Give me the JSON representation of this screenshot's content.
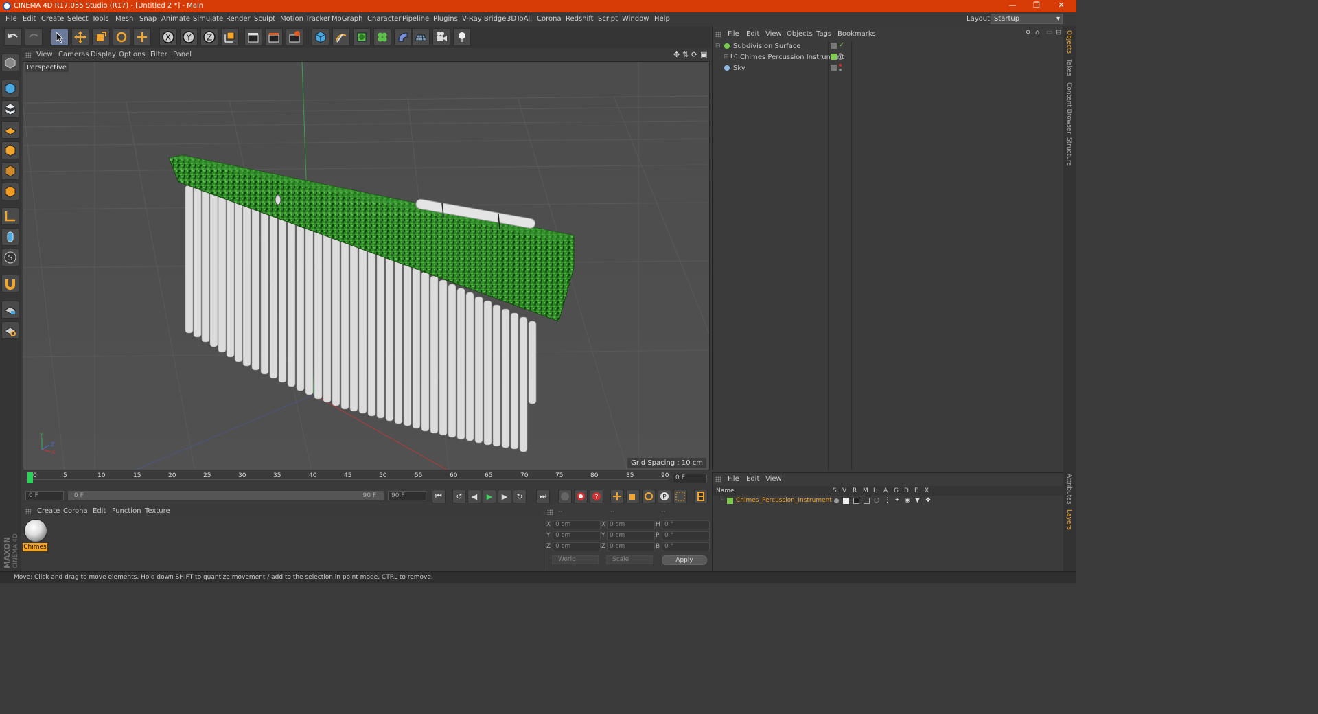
{
  "window": {
    "title": "CINEMA 4D R17.055 Studio (R17) - [Untitled 2 *] - Main"
  },
  "menubar": {
    "items": [
      "File",
      "Edit",
      "Create",
      "Select",
      "Tools",
      "Mesh",
      "Snap",
      "Animate",
      "Simulate",
      "Render",
      "Sculpt",
      "Motion Tracker",
      "MoGraph",
      "Character",
      "Pipeline",
      "Plugins",
      "V-Ray Bridge",
      "3DToAll",
      "Corona",
      "Redshift",
      "Script",
      "Window",
      "Help"
    ],
    "layout_label": "Layout:",
    "layout_value": "Startup"
  },
  "viewport": {
    "menu": [
      "View",
      "Cameras",
      "Display",
      "Options",
      "Filter",
      "Panel"
    ],
    "label": "Perspective",
    "grid_spacing": "Grid Spacing : 10 cm"
  },
  "timeline": {
    "ticks": [
      "0",
      "5",
      "10",
      "15",
      "20",
      "25",
      "30",
      "35",
      "40",
      "45",
      "50",
      "55",
      "60",
      "65",
      "70",
      "75",
      "80",
      "85",
      "90"
    ],
    "current_frame": "0 F"
  },
  "playbar": {
    "start": "0 F",
    "range_start": "0 F",
    "range_end": "90 F",
    "end": "90 F"
  },
  "material_manager": {
    "menu": [
      "Create",
      "Corona",
      "Edit",
      "Function",
      "Texture"
    ],
    "materials": [
      {
        "name": "Chimes"
      }
    ]
  },
  "coordinates": {
    "header": [
      "--",
      "--",
      "--"
    ],
    "rows": [
      {
        "l1": "X",
        "v1": "0 cm",
        "l2": "X",
        "v2": "0 cm",
        "l3": "H",
        "v3": "0 °"
      },
      {
        "l1": "Y",
        "v1": "0 cm",
        "l2": "Y",
        "v2": "0 cm",
        "l3": "P",
        "v3": "0 °"
      },
      {
        "l1": "Z",
        "v1": "0 cm",
        "l2": "Z",
        "v2": "0 cm",
        "l3": "B",
        "v3": "0 °"
      }
    ],
    "mode": "World",
    "scale": "Scale",
    "apply": "Apply"
  },
  "object_manager": {
    "menu": [
      "File",
      "Edit",
      "View",
      "Objects",
      "Tags",
      "Bookmarks"
    ],
    "objects": [
      {
        "name": "Subdivision Surface"
      },
      {
        "name": "Chimes Percussion Instrument"
      },
      {
        "name": "Sky"
      }
    ]
  },
  "side_tabs": [
    "Objects",
    "Takes",
    "Content Browser",
    "Structure"
  ],
  "side_tabs_lower": [
    "Attributes",
    "Layers"
  ],
  "layer_manager": {
    "menu": [
      "File",
      "Edit",
      "View"
    ],
    "columns": [
      "Name",
      "S",
      "V",
      "R",
      "M",
      "L",
      "A",
      "G",
      "D",
      "E",
      "X"
    ],
    "layers": [
      {
        "name": "Chimes_Percussion_Instrument"
      }
    ]
  },
  "status": "Move: Click and drag to move elements. Hold down SHIFT to quantize movement / add to the selection in point mode, CTRL to remove.",
  "logo": {
    "line1": "MAXON",
    "line2": "CINEMA 4D"
  },
  "colors": {
    "accent": "#d73b06",
    "highlight": "#f3a52c",
    "object_green": "#7ec850"
  }
}
